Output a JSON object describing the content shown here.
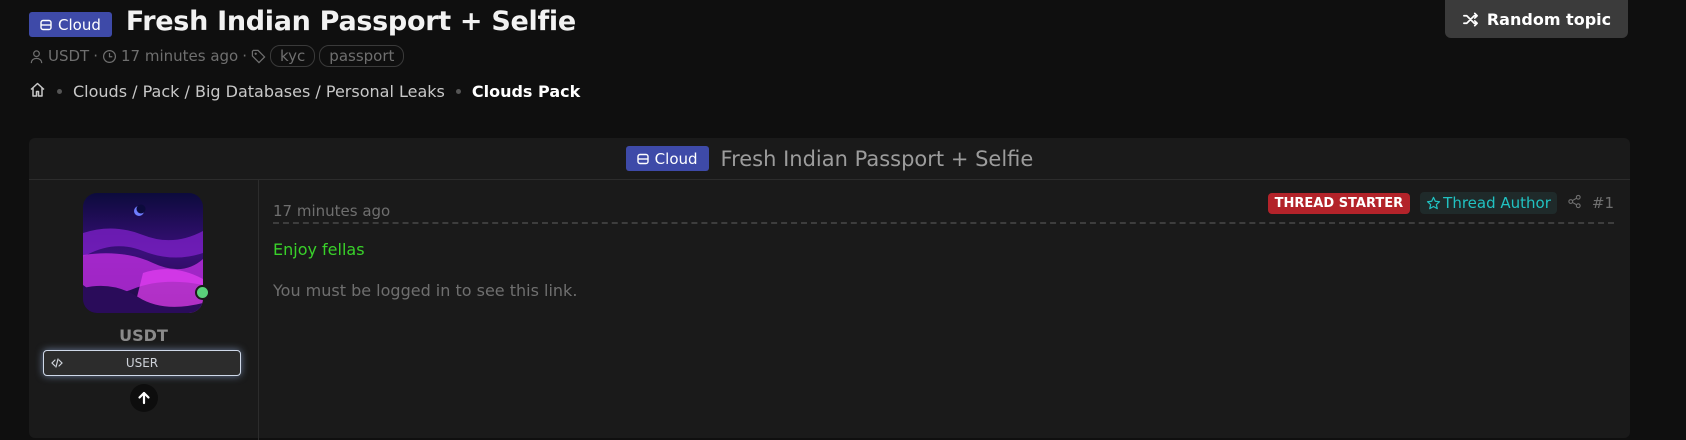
{
  "thread": {
    "prefix": "Cloud",
    "title": "Fresh Indian Passport + Selfie",
    "author": "USDT",
    "time": "17 minutes ago",
    "tags": [
      "kyc",
      "passport"
    ]
  },
  "breadcrumb": {
    "path": "Clouds / Pack / Big Databases / Personal Leaks",
    "current": "Clouds Pack"
  },
  "random_button": {
    "label": "Random topic"
  },
  "post": {
    "header_prefix": "Cloud",
    "header_title": "Fresh Indian Passport + Selfie",
    "username": "USDT",
    "role": "USER",
    "time": "17 minutes ago",
    "starter_badge": "THREAD STARTER",
    "author_badge": "Thread Author",
    "number": "#1",
    "message": "Enjoy fellas",
    "login_notice": "You must be logged in to see this link."
  },
  "colors": {
    "prefix_badge": "#3e4aa8",
    "starter_badge": "#b3232a",
    "author_badge_text": "#21c2c2",
    "message_text": "#39d12a",
    "online_dot": "#5ad17a"
  },
  "icons": [
    "database-icon",
    "user-icon",
    "clock-icon",
    "tag-icon",
    "home-icon",
    "shuffle-icon",
    "star-icon",
    "share-icon",
    "code-icon",
    "arrow-up-icon"
  ]
}
